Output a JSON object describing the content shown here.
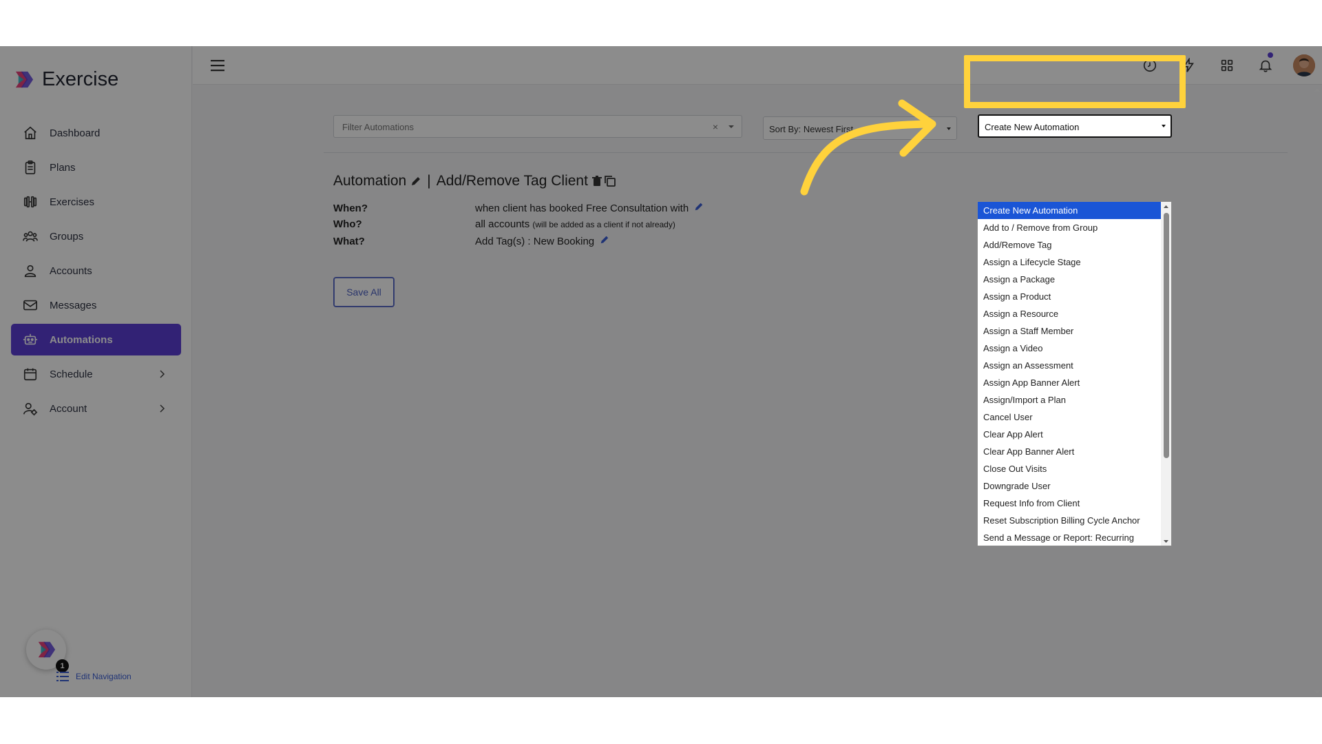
{
  "brand": {
    "name": "Exercise"
  },
  "sidebar": {
    "items": [
      {
        "label": "Dashboard",
        "icon": "home-icon"
      },
      {
        "label": "Plans",
        "icon": "clipboard-icon"
      },
      {
        "label": "Exercises",
        "icon": "dumbbell-icon"
      },
      {
        "label": "Groups",
        "icon": "users-icon"
      },
      {
        "label": "Accounts",
        "icon": "user-icon"
      },
      {
        "label": "Messages",
        "icon": "envelope-icon"
      },
      {
        "label": "Automations",
        "icon": "robot-icon",
        "active": true
      },
      {
        "label": "Schedule",
        "icon": "calendar-icon",
        "has_chevron": true
      },
      {
        "label": "Account",
        "icon": "user-gear-icon",
        "has_chevron": true
      }
    ],
    "fab_badge": "1",
    "edit_navigation": "Edit Navigation"
  },
  "toolbar": {
    "filter_placeholder": "Filter Automations",
    "filter_clear": "×",
    "sort_label": "Sort By: Newest First",
    "create_label": "Create New Automation"
  },
  "automation": {
    "title_prefix": "Automation",
    "title_separator": "|",
    "title_name": "Add/Remove Tag Client",
    "when_label": "When?",
    "when_value": "when client has booked Free Consultation with",
    "who_label": "Who?",
    "who_value": "all accounts",
    "who_note": "(will be added as a client if not already)",
    "what_label": "What?",
    "what_value": "Add Tag(s) : New Booking"
  },
  "save_all_label": "Save All",
  "dropdown_options": [
    "Create New Automation",
    "Add to / Remove from Group",
    "Add/Remove Tag",
    "Assign a Lifecycle Stage",
    "Assign a Package",
    "Assign a Product",
    "Assign a Resource",
    "Assign a Staff Member",
    "Assign a Video",
    "Assign an Assessment",
    "Assign App Banner Alert",
    "Assign/Import a Plan",
    "Cancel User",
    "Clear App Alert",
    "Clear App Banner Alert",
    "Close Out Visits",
    "Downgrade User",
    "Request Info from Client",
    "Reset Subscription Billing Cycle Anchor",
    "Send a Message or Report: Recurring"
  ],
  "colors": {
    "accent": "#5b3ed6",
    "highlight": "#ffd23c",
    "link": "#3a5ed6",
    "selected_option": "#1a55d6"
  }
}
